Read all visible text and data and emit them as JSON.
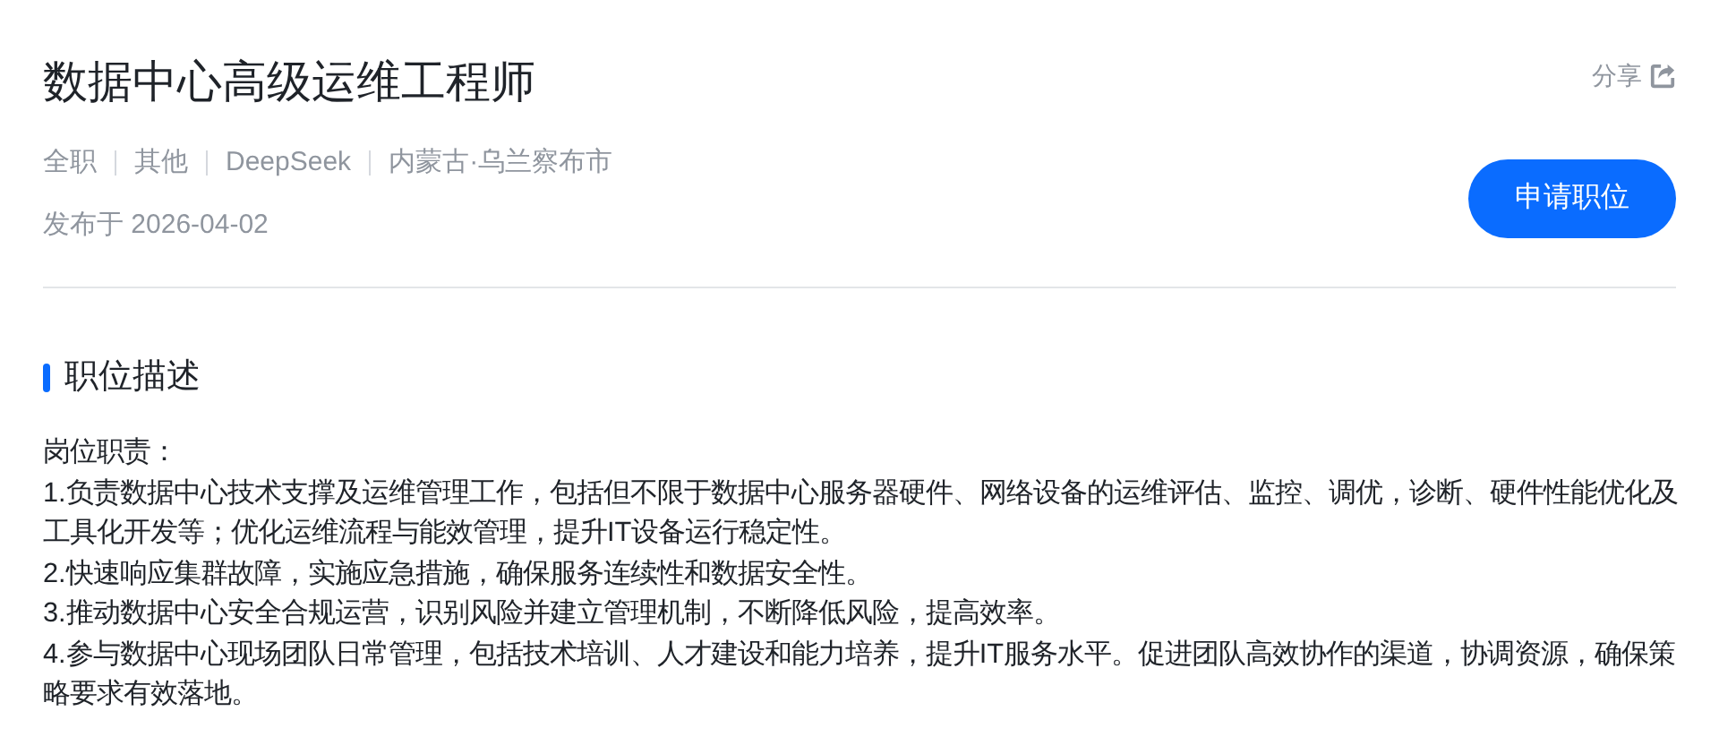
{
  "job": {
    "title": "数据中心高级运维工程师",
    "share": {
      "label": "分享"
    },
    "meta": [
      "全职",
      "其他",
      "DeepSeek",
      "内蒙古·乌兰察布市"
    ],
    "published": "发布于 2026-04-02",
    "apply_button": "申请职位"
  },
  "description": {
    "heading": "职位描述",
    "paragraphs": [
      "岗位职责：",
      "1.负责数据中心技术支撑及运维管理工作，包括但不限于数据中心服务器硬件、网络设备的运维评估、监控、调优，诊断、硬件性能优化及工具化开发等；优化运维流程与能效管理，提升IT设备运行稳定性。",
      "2.快速响应集群故障，实施应急措施，确保服务连续性和数据安全性。",
      "3.推动数据中心安全合规运营，识别风险并建立管理机制，不断降低风险，提高效率。",
      "4.参与数据中心现场团队日常管理，包括技术培训、人才建设和能力培养，提升IT服务水平。促进团队高效协作的渠道，协调资源，确保策略要求有效落地。"
    ]
  }
}
